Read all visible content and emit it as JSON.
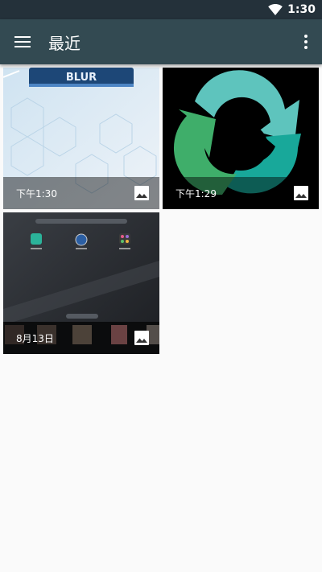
{
  "status_bar": {
    "time": "1:30",
    "wifi_icon": "wifi-icon"
  },
  "app_bar": {
    "title": "最近",
    "menu_icon": "menu-icon",
    "overflow_icon": "more-vert-icon"
  },
  "grid": {
    "items": [
      {
        "caption": "下午1:30",
        "type_icon": "image-icon",
        "thumb_text": "BLUR"
      },
      {
        "caption": "下午1:29",
        "type_icon": "image-icon"
      },
      {
        "caption": "8月13日",
        "type_icon": "image-icon"
      }
    ]
  },
  "colors": {
    "status_bar": "#24313a",
    "app_bar": "#334a52",
    "background": "#fafafa"
  }
}
